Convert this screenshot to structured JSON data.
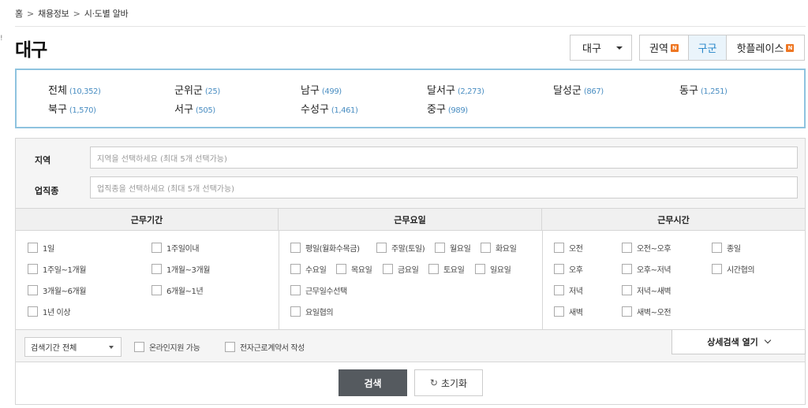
{
  "breadcrumb": {
    "home": "홈",
    "jobs": "채용정보",
    "current": "시·도별 알바",
    "sep1": ">",
    "sep2": ">"
  },
  "edge_mark": "!",
  "page_title": "대구",
  "city_select": {
    "value": "대구"
  },
  "view_tabs": [
    {
      "label": "권역",
      "badge": "N"
    },
    {
      "label": "구군",
      "active": true
    },
    {
      "label": "핫플레이스",
      "badge": "N"
    }
  ],
  "districts": [
    {
      "name": "전체",
      "count": "(10,352)"
    },
    {
      "name": "군위군",
      "count": "(25)"
    },
    {
      "name": "남구",
      "count": "(499)"
    },
    {
      "name": "달서구",
      "count": "(2,273)"
    },
    {
      "name": "달성군",
      "count": "(867)"
    },
    {
      "name": "동구",
      "count": "(1,251)"
    },
    {
      "name": "북구",
      "count": "(1,570)"
    },
    {
      "name": "서구",
      "count": "(505)"
    },
    {
      "name": "수성구",
      "count": "(1,461)"
    },
    {
      "name": "중구",
      "count": "(989)"
    }
  ],
  "filters": {
    "region": {
      "label": "지역",
      "placeholder": "지역을 선택하세요 (최대 5개 선택가능)"
    },
    "job": {
      "label": "업직종",
      "placeholder": "업직종을 선택하세요 (최대 5개 선택가능)"
    }
  },
  "conditions": {
    "period": {
      "title": "근무기간",
      "options": [
        "1일",
        "1주일이내",
        "1주일~1개월",
        "1개월~3개월",
        "3개월~6개월",
        "6개월~1년",
        "1년 이상"
      ]
    },
    "days": {
      "title": "근무요일",
      "options": [
        "평일(월화수목금)",
        "주말(토일)",
        "월요일",
        "화요일",
        "수요일",
        "목요일",
        "금요일",
        "토요일",
        "일요일",
        "근무일수선택",
        "요일협의"
      ]
    },
    "hours": {
      "title": "근무시간",
      "options": [
        "오전",
        "오전~오후",
        "종일",
        "오후",
        "오후~저녁",
        "시간협의",
        "저녁",
        "저녁~새벽",
        "새벽",
        "새벽~오전"
      ]
    }
  },
  "options_bar": {
    "period_select": "검색기간 전체",
    "online_apply": "온라인지원 가능",
    "e_contract": "전자근로계약서 작성",
    "detail_toggle": "상세검색 열기"
  },
  "actions": {
    "search": "검색",
    "reset": "초기화",
    "reset_icon": "↻"
  }
}
